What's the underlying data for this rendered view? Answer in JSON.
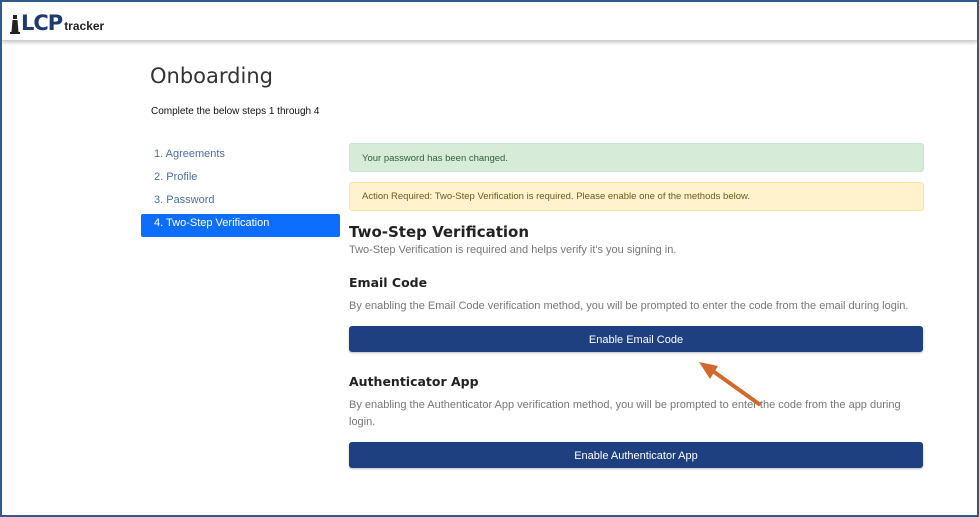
{
  "header": {
    "logo_main": "LCP",
    "logo_sub": "tracker"
  },
  "page": {
    "title": "Onboarding",
    "subtitle": "Complete the below steps 1 through 4"
  },
  "steps": [
    {
      "label": "1. Agreements",
      "active": false
    },
    {
      "label": "2. Profile",
      "active": false
    },
    {
      "label": "3. Password",
      "active": false
    },
    {
      "label": "4. Two-Step Verification",
      "active": true
    }
  ],
  "alerts": {
    "success": "Your password has been changed.",
    "warning": "Action Required: Two-Step Verification is required. Please enable one of the methods below."
  },
  "two_step": {
    "title": "Two-Step Verification",
    "description": "Two-Step Verification is required and helps verify it's you signing in."
  },
  "email_code": {
    "title": "Email Code",
    "description": "By enabling the Email Code verification method, you will be prompted to enter the code from the email during login.",
    "button_label": "Enable Email Code"
  },
  "authenticator": {
    "title": "Authenticator App",
    "description": "By enabling the Authenticator App verification method, you will be prompted to enter the code from the app during login.",
    "button_label": "Enable Authenticator App"
  },
  "colors": {
    "border": "#2e5b8c",
    "primary_button": "#1e3f80",
    "active_step": "#0d6efd",
    "annotation_arrow": "#d2692a"
  },
  "annotation": {
    "icon": "arrow-pointer-icon"
  }
}
